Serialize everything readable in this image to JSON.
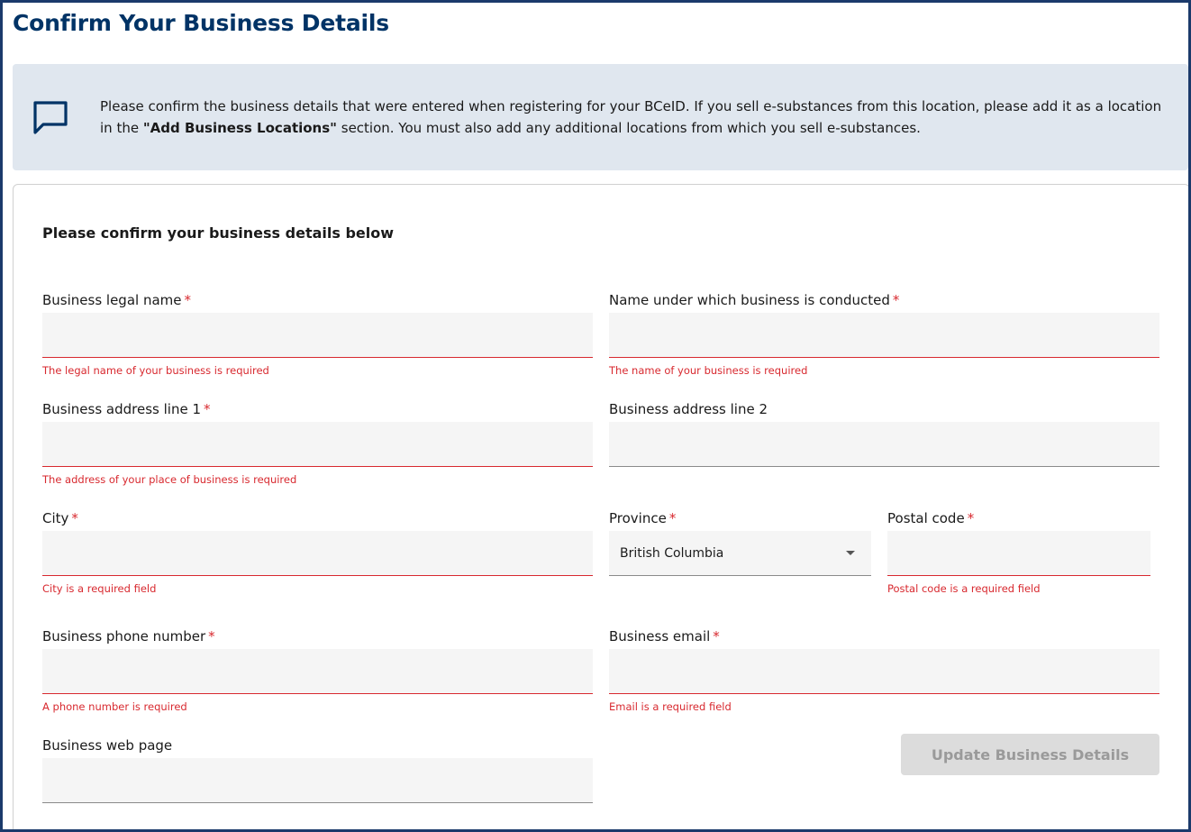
{
  "page": {
    "title": "Confirm Your Business Details"
  },
  "banner": {
    "icon": "chat-bubble-icon",
    "text_before": "Please confirm the business details that were entered when registering for your BCeID. If you sell e-substances from this location, please add it as a location in the ",
    "text_bold": "\"Add Business Locations\"",
    "text_after": " section. You must also add any additional locations from which you sell e-substances."
  },
  "form": {
    "heading": "Please confirm your business details below",
    "required_marker": "*",
    "fields": {
      "legal_name": {
        "label": "Business legal name",
        "value": "",
        "error": "The legal name of your business is required"
      },
      "dba_name": {
        "label": "Name under which business is conducted",
        "value": "",
        "error": "The name of your business is required"
      },
      "address1": {
        "label": "Business address line 1",
        "value": "",
        "error": "The address of your place of business is required"
      },
      "address2": {
        "label": "Business address line 2",
        "value": ""
      },
      "city": {
        "label": "City",
        "value": "",
        "error": "City is a required field"
      },
      "province": {
        "label": "Province",
        "value": "British Columbia"
      },
      "postal": {
        "label": "Postal code",
        "value": "",
        "error": "Postal code is a required field"
      },
      "phone": {
        "label": "Business phone number",
        "value": "",
        "error": "A phone number is required"
      },
      "email": {
        "label": "Business email",
        "value": "",
        "error": "Email is a required field"
      },
      "web": {
        "label": "Business web page",
        "value": ""
      }
    },
    "submit_label": "Update Business Details"
  },
  "colors": {
    "title": "#003366",
    "banner_bg": "#e0e7ef",
    "error": "#d8292f",
    "input_bg": "#f5f5f5",
    "button_disabled_bg": "#dcdcdc",
    "button_disabled_text": "#9a9a9a"
  }
}
